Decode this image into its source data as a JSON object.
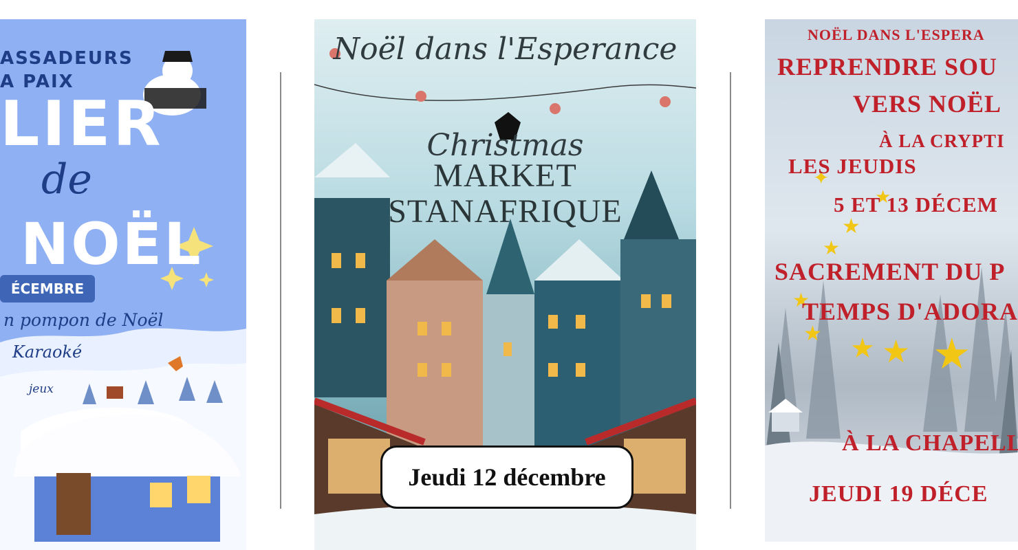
{
  "posters": [
    {
      "line1": "ASSADEURS",
      "line2": "A PAIX",
      "title_a": "LIER",
      "title_b": "de",
      "title_c": "NOËL",
      "badge": "ÉCEMBRE",
      "activity1": "n pompon de Noël",
      "activity2": "Karaoké",
      "activity3": "jeux"
    },
    {
      "heading": "Noël dans l'Esperance",
      "christmas": "Christmas",
      "market": "MARKET",
      "stanafrique": "STANAFRIQUE",
      "date": "Jeudi 12 décembre"
    },
    {
      "line1": "NOËL DANS L'ESPERA",
      "line2": "REPRENDRE SOU",
      "line3": "VERS NOËL",
      "line4": "À LA CRYPTI",
      "line5": "LES JEUDIS",
      "line6": "5 ET 13 DÉCEM",
      "line7": "SACREMENT DU P",
      "line8": "TEMPS D'ADORA",
      "line9": "À LA CHAPELL",
      "line10": "JEUDI 19 DÉCE"
    }
  ],
  "colors": {
    "poster1_bg": "#8fb0f2",
    "poster3_text": "#c0202a",
    "star": "#f2c614"
  }
}
